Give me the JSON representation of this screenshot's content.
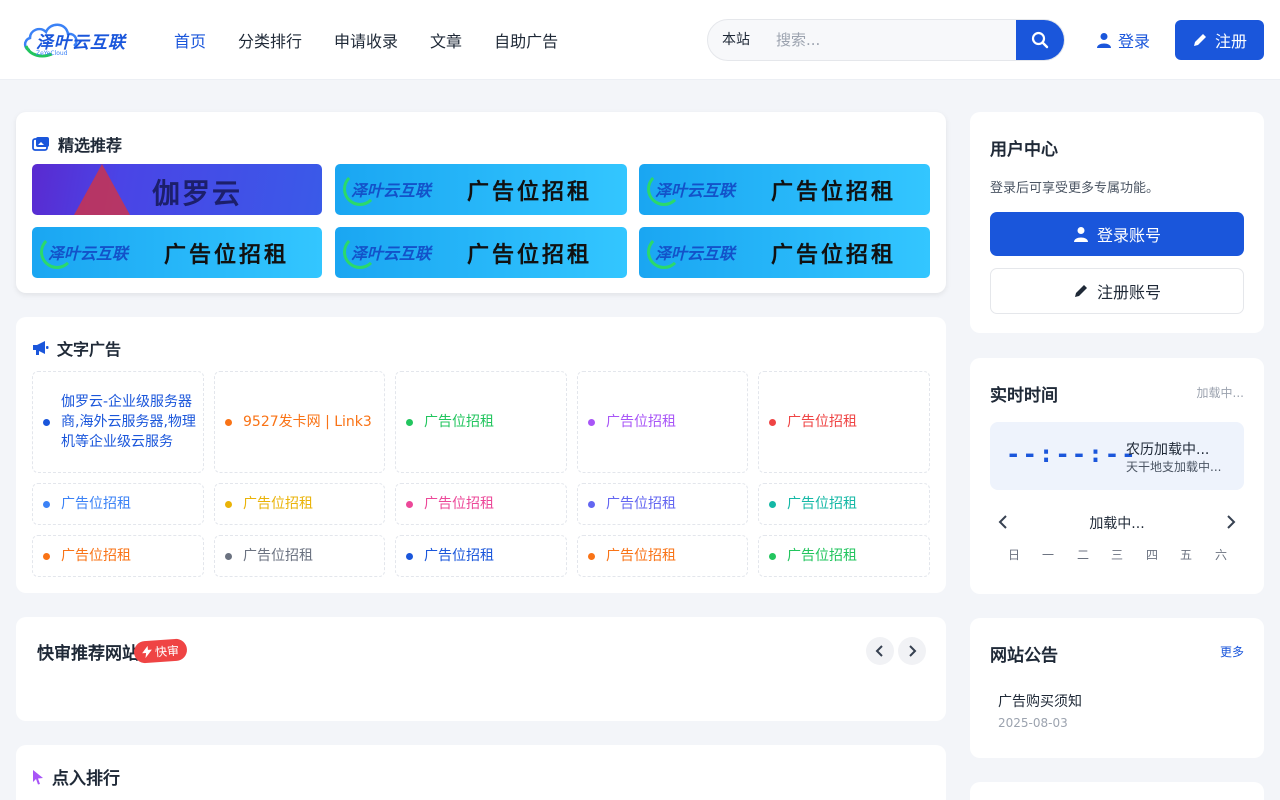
{
  "header": {
    "logo_text": "泽叶云互联",
    "logo_sub": "ZeYeCloud",
    "nav": [
      "首页",
      "分类排行",
      "申请收录",
      "文章",
      "自助广告"
    ],
    "search_scope": "本站",
    "search_placeholder": "搜索...",
    "login": "登录",
    "register": "注册"
  },
  "featured": {
    "title": "精选推荐",
    "banners": [
      {
        "logo": "",
        "text": "伽罗云"
      },
      {
        "logo": "泽叶云互联",
        "text": "广告位招租"
      },
      {
        "logo": "泽叶云互联",
        "text": "广告位招租"
      },
      {
        "logo": "泽叶云互联",
        "text": "广告位招租"
      },
      {
        "logo": "泽叶云互联",
        "text": "广告位招租"
      },
      {
        "logo": "泽叶云互联",
        "text": "广告位招租"
      }
    ]
  },
  "text_ads": {
    "title": "文字广告",
    "items": [
      {
        "text": "伽罗云-企业级服务器商,海外云服务器,物理机等企业级云服务",
        "color": "#1a56db"
      },
      {
        "text": "9527发卡网 | Link3",
        "color": "#f97316"
      },
      {
        "text": "广告位招租",
        "color": "#22c55e"
      },
      {
        "text": "广告位招租",
        "color": "#a855f7"
      },
      {
        "text": "广告位招租",
        "color": "#ef4444"
      },
      {
        "text": "广告位招租",
        "color": "#3b82f6"
      },
      {
        "text": "广告位招租",
        "color": "#eab308"
      },
      {
        "text": "广告位招租",
        "color": "#ec4899"
      },
      {
        "text": "广告位招租",
        "color": "#6366f1"
      },
      {
        "text": "广告位招租",
        "color": "#14b8a6"
      },
      {
        "text": "广告位招租",
        "color": "#f97316"
      },
      {
        "text": "广告位招租",
        "color": "#6b7280"
      },
      {
        "text": "广告位招租",
        "color": "#1a56db"
      },
      {
        "text": "广告位招租",
        "color": "#f97316"
      },
      {
        "text": "广告位招租",
        "color": "#22c55e"
      }
    ]
  },
  "quick_review": {
    "title": "快审推荐网站",
    "badge": "快审"
  },
  "ranking": {
    "title": "点入排行"
  },
  "user_center": {
    "title": "用户中心",
    "desc": "登录后可享受更多专属功能。",
    "login_btn": "登录账号",
    "register_btn": "注册账号"
  },
  "realtime": {
    "title": "实时时间",
    "status": "加载中...",
    "clock": "--:--:--",
    "lunar": "农历加载中...",
    "ganzhi": "天干地支加载中...",
    "month": "加载中...",
    "weekdays": [
      "日",
      "一",
      "二",
      "三",
      "四",
      "五",
      "六"
    ]
  },
  "notice": {
    "title": "网站公告",
    "more": "更多",
    "items": [
      {
        "title": "广告购买须知",
        "date": "2025-08-03"
      }
    ]
  }
}
